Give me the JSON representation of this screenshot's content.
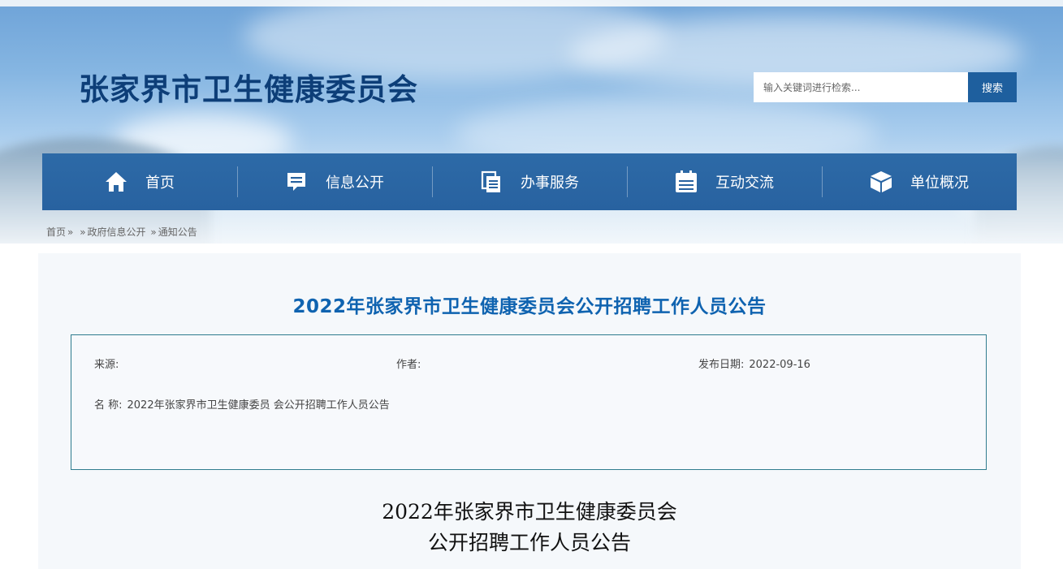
{
  "header": {
    "site_title": "张家界市卫生健康委员会",
    "search_placeholder": "输入关键词进行检索...",
    "search_button": "搜索"
  },
  "nav": {
    "items": [
      {
        "label": "首页",
        "icon": "home-icon"
      },
      {
        "label": "信息公开",
        "icon": "message-icon"
      },
      {
        "label": "办事服务",
        "icon": "documents-icon"
      },
      {
        "label": "互动交流",
        "icon": "clipboard-icon"
      },
      {
        "label": "单位概况",
        "icon": "cube-icon"
      }
    ]
  },
  "breadcrumb": {
    "home": "首页",
    "sep1": "»",
    "sep2": "»",
    "level1": "政府信息公开",
    "sep3": "»",
    "level2": "通知公告"
  },
  "article": {
    "title": "2022年张家界市卫生健康委员会公开招聘工作人员公告",
    "source_label": "来源:",
    "source_value": "",
    "author_label": "作者:",
    "author_value": "",
    "date_label": "发布日期:",
    "date_value": "2022-09-16",
    "name_label": "名 称:",
    "name_value": "2022年张家界市卫生健康委员 会公开招聘工作人员公告",
    "body_heading_line1": "2022年张家界市卫生健康委员会",
    "body_heading_line2": "公开招聘工作人员公告"
  },
  "colors": {
    "nav_bg": "#2862a0",
    "title_blue": "#0f63b0",
    "site_title": "#0d3e78",
    "search_button": "#1e5f9e"
  }
}
